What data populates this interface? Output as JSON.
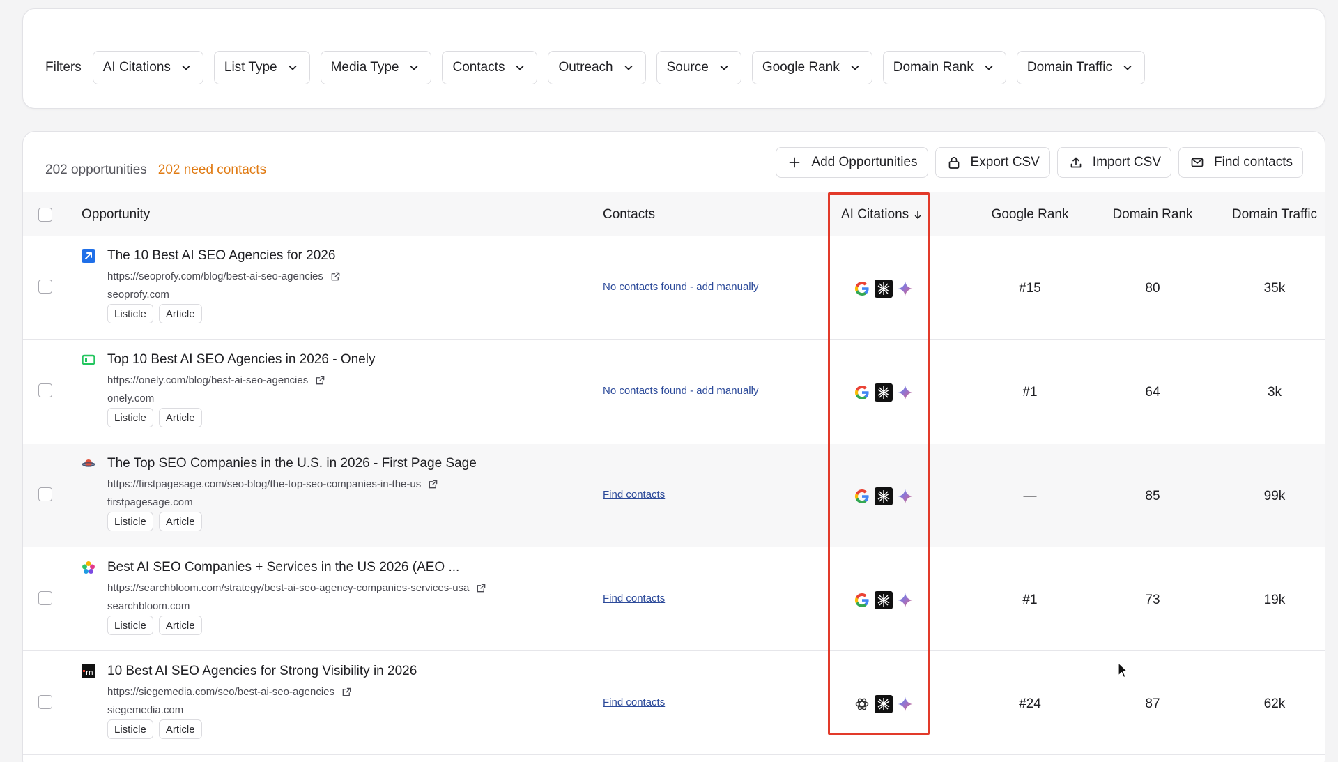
{
  "filters": {
    "label": "Filters",
    "items": [
      "AI Citations",
      "List Type",
      "Media Type",
      "Contacts",
      "Outreach",
      "Source",
      "Google Rank",
      "Domain Rank",
      "Domain Traffic"
    ]
  },
  "summary": {
    "count": "202 opportunities",
    "need_contacts": "202 need contacts"
  },
  "actions": {
    "add": "Add Opportunities",
    "export": "Export CSV",
    "import": "Import CSV",
    "find": "Find contacts"
  },
  "columns": {
    "opportunity": "Opportunity",
    "contacts": "Contacts",
    "ai_citations": "AI Citations",
    "google_rank": "Google Rank",
    "domain_rank": "Domain Rank",
    "domain_traffic": "Domain Traffic"
  },
  "rows": [
    {
      "title": "The 10 Best AI SEO Agencies for 2026",
      "url": "https://seoprofy.com/blog/best-ai-seo-agencies",
      "domain": "seoprofy.com",
      "tags": [
        "Listicle",
        "Article"
      ],
      "contacts": "No contacts found - add manually",
      "citation_icons": [
        "google-icon",
        "perplexity-icon",
        "gemini-icon"
      ],
      "google_rank": "#15",
      "domain_rank": "80",
      "domain_traffic": "35k"
    },
    {
      "title": "Top 10 Best AI SEO Agencies in 2026 - Onely",
      "url": "https://onely.com/blog/best-ai-seo-agencies",
      "domain": "onely.com",
      "tags": [
        "Listicle",
        "Article"
      ],
      "contacts": "No contacts found - add manually",
      "citation_icons": [
        "google-icon",
        "perplexity-icon",
        "gemini-icon"
      ],
      "google_rank": "#1",
      "domain_rank": "64",
      "domain_traffic": "3k"
    },
    {
      "title": "The Top SEO Companies in the U.S. in 2026 - First Page Sage",
      "url": "https://firstpagesage.com/seo-blog/the-top-seo-companies-in-the-us",
      "domain": "firstpagesage.com",
      "tags": [
        "Listicle",
        "Article"
      ],
      "contacts": "Find contacts",
      "citation_icons": [
        "google-icon",
        "perplexity-icon",
        "gemini-icon"
      ],
      "google_rank": "—",
      "domain_rank": "85",
      "domain_traffic": "99k"
    },
    {
      "title": "Best AI SEO Companies + Services in the US 2026 (AEO ...",
      "url": "https://searchbloom.com/strategy/best-ai-seo-agency-companies-services-usa",
      "domain": "searchbloom.com",
      "tags": [
        "Listicle",
        "Article"
      ],
      "contacts": "Find contacts",
      "citation_icons": [
        "google-icon",
        "perplexity-icon",
        "gemini-icon"
      ],
      "google_rank": "#1",
      "domain_rank": "73",
      "domain_traffic": "19k"
    },
    {
      "title": "10 Best AI SEO Agencies for Strong Visibility in 2026",
      "url": "https://siegemedia.com/seo/best-ai-seo-agencies",
      "domain": "siegemedia.com",
      "tags": [
        "Listicle",
        "Article"
      ],
      "contacts": "Find contacts",
      "citation_icons": [
        "openai-icon",
        "perplexity-icon",
        "gemini-icon"
      ],
      "google_rank": "#24",
      "domain_rank": "87",
      "domain_traffic": "62k"
    }
  ],
  "colors": {
    "accent_orange": "#e07a12",
    "link_blue": "#2c4a9a",
    "highlight_red": "#e23a2a"
  }
}
